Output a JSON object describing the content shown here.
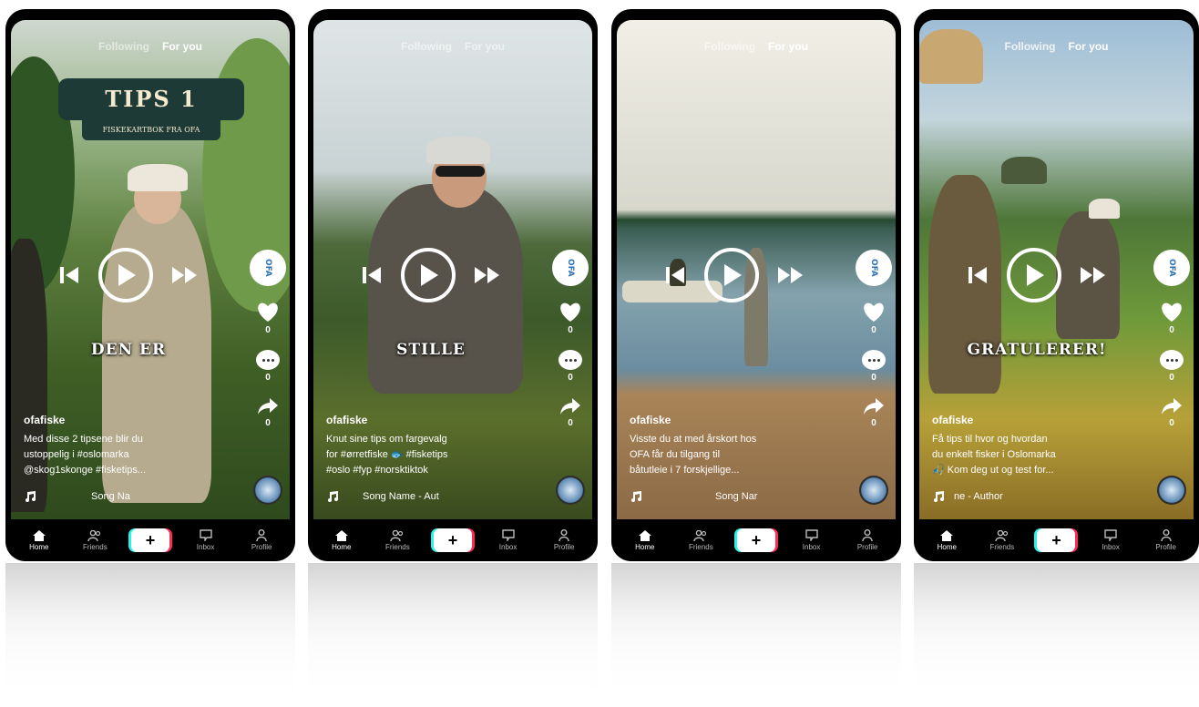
{
  "top_tabs": {
    "following": "Following",
    "for_you": "For you"
  },
  "nav": {
    "home": "Home",
    "friends": "Friends",
    "create": "+",
    "inbox": "Inbox",
    "profile": "Profile"
  },
  "phones": [
    {
      "banner_title": "TIPS 1",
      "banner_subtitle": "FISKEKARTBOK FRA OFA",
      "overlay": "DEN ER",
      "username": "ofafiske",
      "caption": [
        "Med disse 2 tipsene blir du",
        "ustoppelig i #oslomarka",
        "@skog1skonge #fisketips..."
      ],
      "song": "Song Na",
      "likes": "0",
      "comments": "0",
      "shares": "0"
    },
    {
      "overlay": "STILLE",
      "username": "ofafiske",
      "caption": [
        "Knut sine tips om fargevalg",
        "for #ørretfiske 🐟 #fisketips",
        "#oslo #fyp #norsktiktok"
      ],
      "song": "Song Name - Aut",
      "likes": "0",
      "comments": "0",
      "shares": "0"
    },
    {
      "overlay": "",
      "username": "ofafiske",
      "caption": [
        "Visste du at med årskort hos",
        "OFA får du tilgang til",
        "båtutleie i 7 forskjellige..."
      ],
      "song": "Song Nar",
      "likes": "0",
      "comments": "0",
      "shares": "0"
    },
    {
      "overlay": "GRATULERER!",
      "username": "ofafiske",
      "caption": [
        "Få tips til hvor og hvordan",
        "du enkelt fisker i Oslomarka",
        "🎣 Kom deg ut og test for..."
      ],
      "song": "ne - Author",
      "likes": "0",
      "comments": "0",
      "shares": "0"
    }
  ],
  "avatar_text": "OFA",
  "colors": {
    "banner_bg": "#1d3a36",
    "banner_text": "#f4ead0",
    "cyan": "#25f4ee",
    "red": "#fe2c55"
  }
}
